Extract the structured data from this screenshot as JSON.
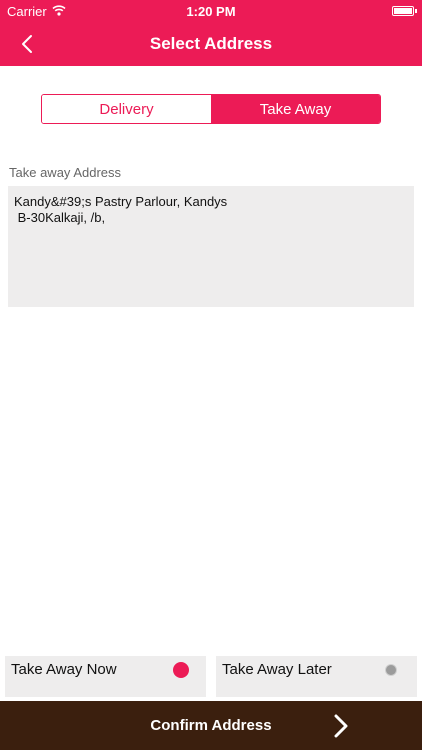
{
  "status_bar": {
    "carrier": "Carrier",
    "time": "1:20 PM"
  },
  "header": {
    "title": "Select Address",
    "back_icon": "chevron-left-icon"
  },
  "segmented_control": {
    "options": [
      "Delivery",
      "Take Away"
    ],
    "selected": "Take Away"
  },
  "address": {
    "label": "Take away Address",
    "value": "Kandy&#39;s Pastry Parlour, Kandys\n B-30Kalkaji, /b,"
  },
  "pickup_options": [
    {
      "label": "Take Away Now",
      "selected": true
    },
    {
      "label": "Take Away Later",
      "selected": false
    }
  ],
  "footer": {
    "confirm_label": "Confirm Address",
    "arrow_icon": "chevron-right-icon"
  },
  "colors": {
    "accent": "#ec1b56",
    "footer_bg": "#3b1f0e",
    "field_bg": "#eeeded"
  }
}
